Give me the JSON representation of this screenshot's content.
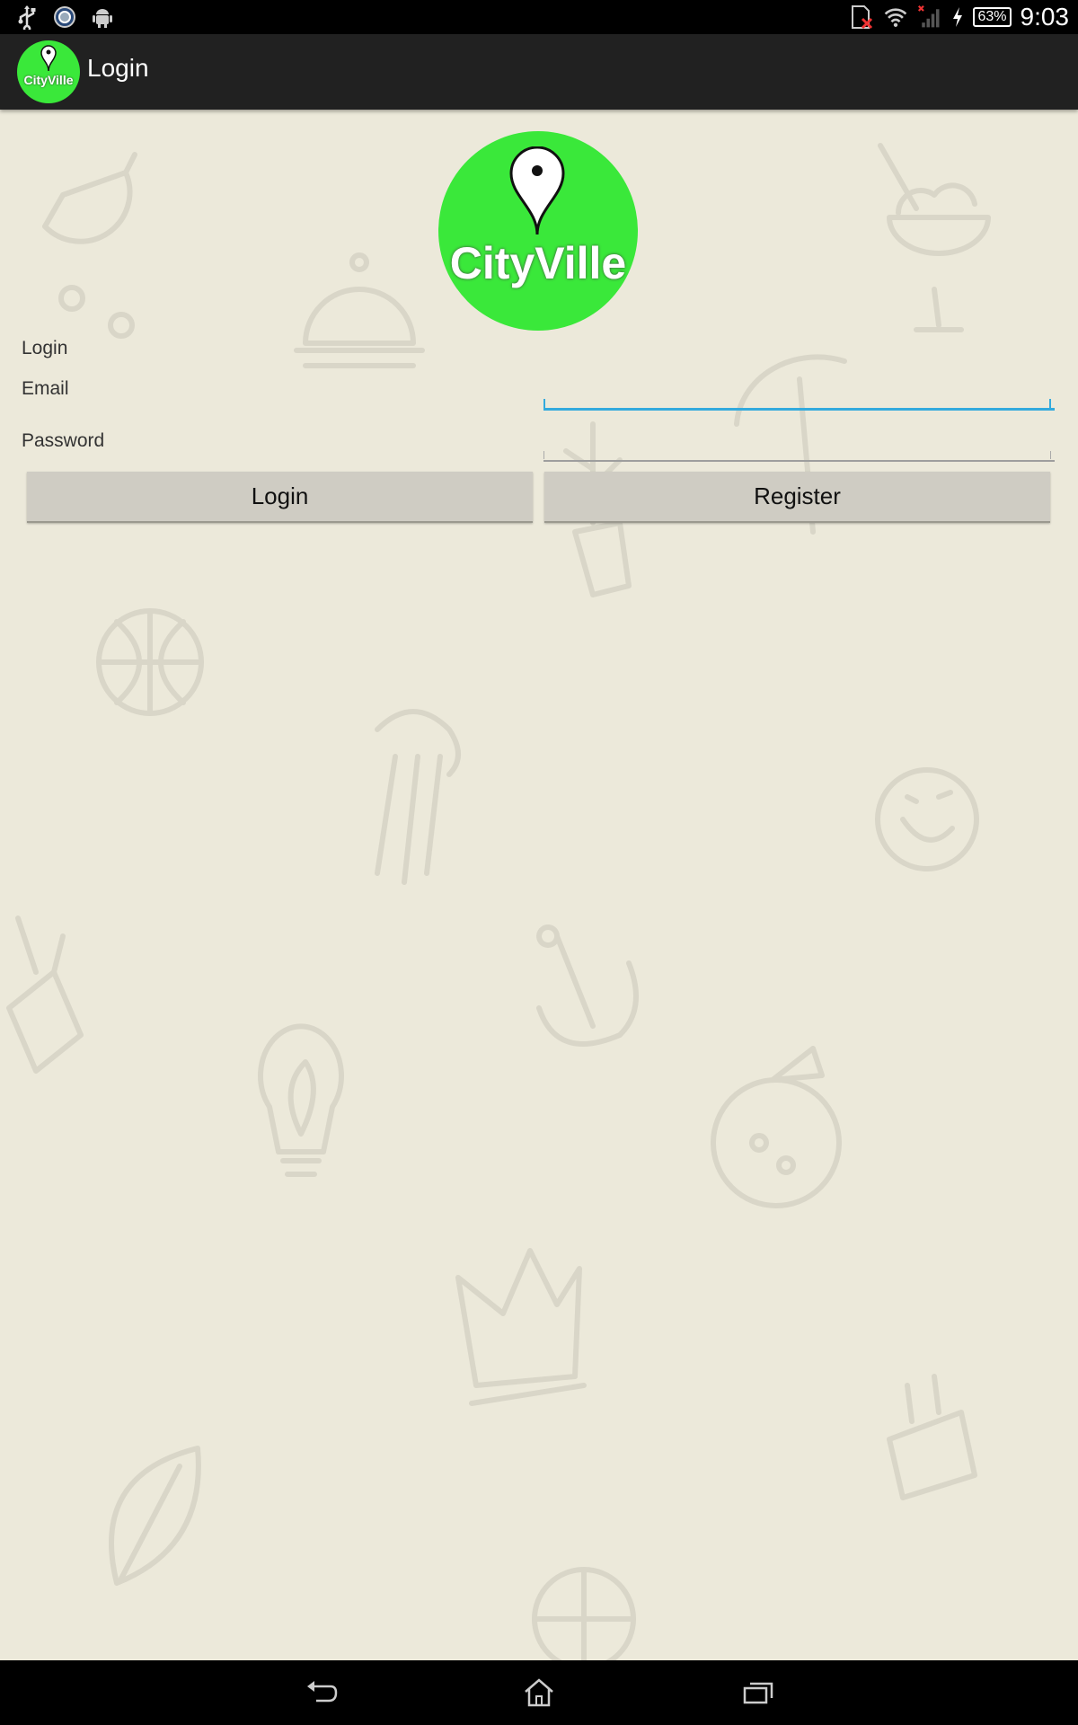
{
  "status_bar": {
    "battery": "63%",
    "time": "9:03",
    "icons": [
      "usb-icon",
      "camera-app-icon",
      "android-icon",
      "no-sim-icon",
      "wifi-icon",
      "signal-icon",
      "charging-icon",
      "battery-icon"
    ]
  },
  "action_bar": {
    "logo_text": "CityVille",
    "title": "Login"
  },
  "main": {
    "logo_text": "CityVille",
    "heading": "Login",
    "email_label": "Email",
    "email_value": "",
    "password_label": "Password",
    "password_value": "",
    "login_button": "Login",
    "register_button": "Register"
  },
  "nav_bar": {
    "buttons": [
      "back-icon",
      "home-icon",
      "recent-apps-icon"
    ]
  },
  "colors": {
    "background": "#ece9da",
    "action_bar": "#212121",
    "logo_green": "#3ae83a",
    "focus_underline": "#33aadd",
    "button": "#cfccc3"
  }
}
